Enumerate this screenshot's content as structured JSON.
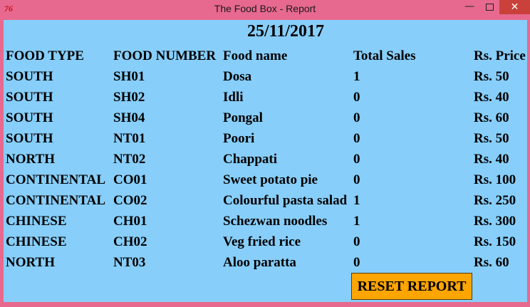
{
  "window": {
    "title": "The Food Box - Report",
    "min_label": "—",
    "close_label": "✕",
    "app_icon_text": "76"
  },
  "report": {
    "date": "25/11/2017",
    "headers": [
      "FOOD TYPE",
      "FOOD NUMBER",
      "Food name",
      "Total Sales",
      "Rs. Price"
    ],
    "rows": [
      [
        "SOUTH",
        "SH01",
        "Dosa",
        "1",
        "Rs. 50"
      ],
      [
        "SOUTH",
        "SH02",
        "Idli",
        "0",
        "Rs. 40"
      ],
      [
        "SOUTH",
        "SH04",
        "Pongal",
        "0",
        "Rs. 60"
      ],
      [
        "SOUTH",
        "NT01",
        "Poori",
        "0",
        "Rs. 50"
      ],
      [
        "NORTH",
        "NT02",
        "Chappati",
        "0",
        "Rs. 40"
      ],
      [
        "CONTINENTAL",
        "CO01",
        "Sweet potato pie",
        "0",
        "Rs. 100"
      ],
      [
        "CONTINENTAL",
        "CO02",
        "Colourful pasta salad",
        "1",
        "Rs. 250"
      ],
      [
        "CHINESE",
        "CH01",
        "Schezwan noodles",
        "1",
        "Rs. 300"
      ],
      [
        "CHINESE",
        "CH02",
        "Veg fried rice",
        "0",
        "Rs. 150"
      ],
      [
        "NORTH",
        "NT03",
        "Aloo paratta",
        "0",
        "Rs. 60"
      ]
    ],
    "reset_label": "RESET REPORT"
  },
  "colors": {
    "titlebar": "#e7698f",
    "content_bg": "#87cefa",
    "reset_button": "#ffa500",
    "close_button": "#c9413a"
  },
  "icons": {
    "app": "tk-feather-icon",
    "minimize": "minimize-icon",
    "maximize": "maximize-icon",
    "close": "close-icon"
  }
}
